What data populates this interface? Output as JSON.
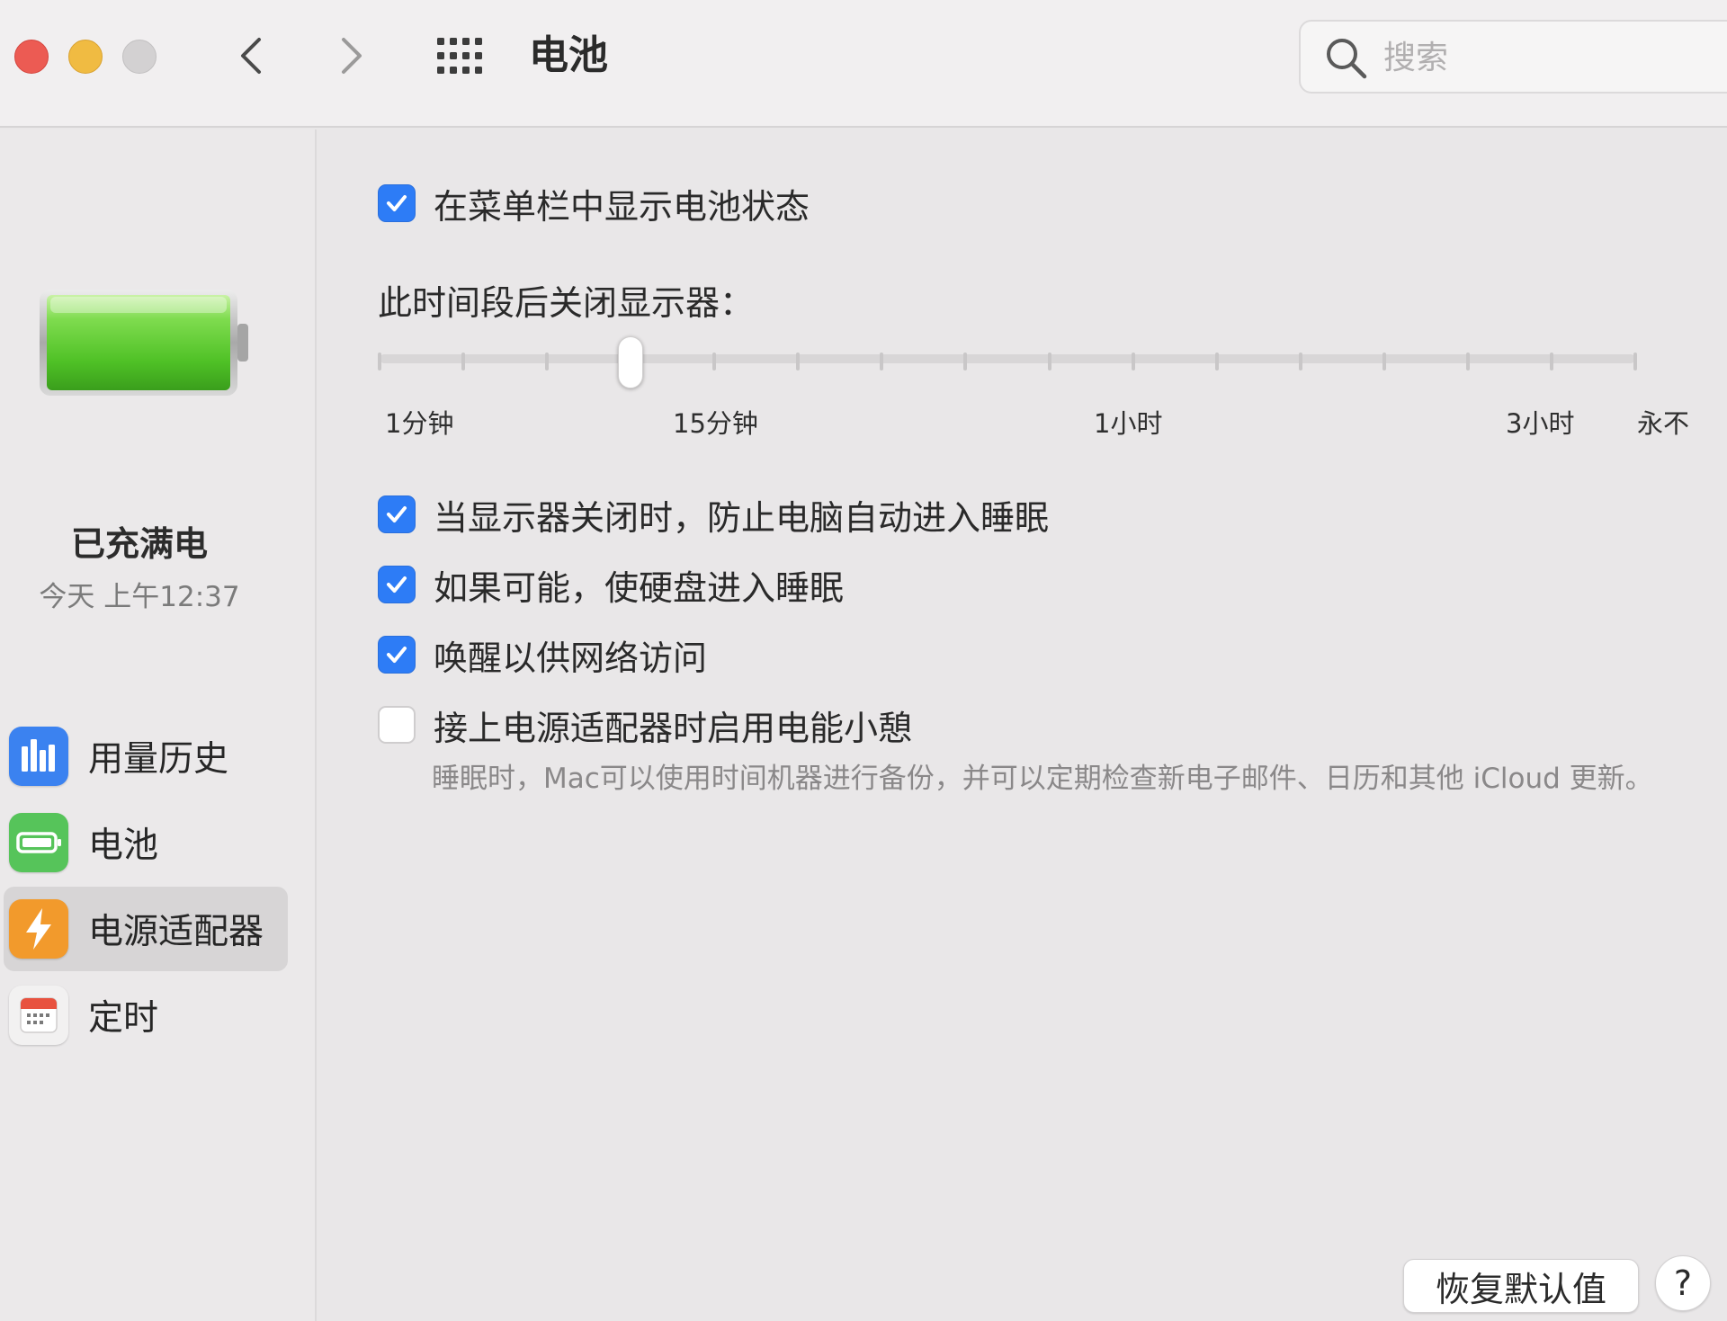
{
  "window": {
    "title": "电池"
  },
  "toolbar": {
    "back_icon": "chevron-left-icon",
    "forward_icon": "chevron-right-icon",
    "grid_icon": "grid-icon",
    "search_placeholder": "搜索"
  },
  "sidebar": {
    "status_title": "已充满电",
    "status_time": "今天 上午12:37",
    "items": [
      {
        "label": "用量历史",
        "icon": "bar-chart-icon",
        "color": "#3b82f0"
      },
      {
        "label": "电池",
        "icon": "battery-icon",
        "color": "#56c45a"
      },
      {
        "label": "电源适配器",
        "icon": "bolt-icon",
        "color": "#f29a2c",
        "selected": true
      },
      {
        "label": "定时",
        "icon": "calendar-icon",
        "color": "#f2f1f1"
      }
    ]
  },
  "main": {
    "show_battery_status": {
      "label": "在菜单栏中显示电池状态",
      "checked": true
    },
    "slider": {
      "title": "此时间段后关闭显示器：",
      "tick_labels": [
        "1分钟",
        "15分钟",
        "1小时",
        "3小时",
        "永不"
      ],
      "tick_count": 16,
      "value_index": 3
    },
    "options": [
      {
        "label": "当显示器关闭时，防止电脑自动进入睡眠",
        "checked": true
      },
      {
        "label": "如果可能，使硬盘进入睡眠",
        "checked": true
      },
      {
        "label": "唤醒以供网络访问",
        "checked": true
      },
      {
        "label": "接上电源适配器时启用电能小憩",
        "checked": false
      }
    ],
    "power_nap_desc": "睡眠时，Mac可以使用时间机器进行备份，并可以定期检查新电子邮件、日历和其他 iCloud 更新。",
    "restore_label": "恢复默认值",
    "help_label": "?"
  },
  "colors": {
    "accent": "#2d7cf6",
    "battery_green": "#5fd23a"
  }
}
